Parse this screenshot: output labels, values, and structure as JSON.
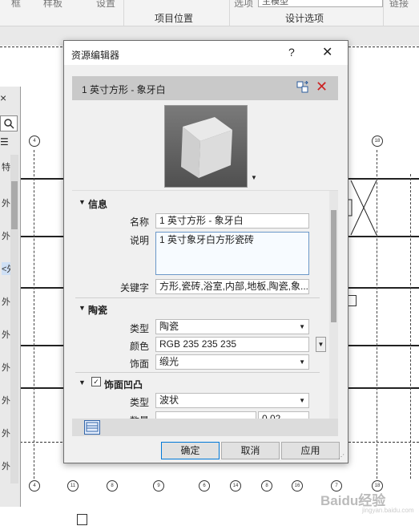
{
  "ribbon": {
    "partial_labels": [
      "框",
      "样板",
      "设置",
      "选项",
      "链接"
    ],
    "location_group": "项目位置",
    "design_options_group": "设计选项",
    "main_model_value": "主模型"
  },
  "browser": {
    "close_glyph": "×",
    "view_glyph": "☰",
    "header_fragment": "特",
    "rows": [
      "外",
      "外",
      "<外",
      "外",
      "外",
      "外",
      "外",
      "外",
      "外"
    ]
  },
  "grid_bubbles": {
    "top": [
      "4",
      "18"
    ],
    "bottom": [
      "4",
      "11",
      "8",
      "9",
      "6",
      "14",
      "8",
      "16",
      "7",
      "18"
    ]
  },
  "dialog": {
    "title": "资源编辑器",
    "help_glyph": "?",
    "close_glyph": "✕",
    "asset_name": "1 英寸方形 - 象牙白",
    "delete_glyph": "✕",
    "sections": {
      "info": {
        "header": "信息",
        "name_label": "名称",
        "name_value": "1 英寸方形 - 象牙白",
        "desc_label": "说明",
        "desc_value": "1 英寸象牙白方形瓷砖",
        "keywords_label": "关键字",
        "keywords_value": "方形,瓷砖,浴室,内部,地板,陶瓷,象..."
      },
      "ceramic": {
        "header": "陶瓷",
        "type_label": "类型",
        "type_value": "陶瓷",
        "color_label": "颜色",
        "color_value": "RGB 235 235 235",
        "finish_label": "饰面",
        "finish_value": "缎光"
      },
      "bump": {
        "header": "饰面凹凸",
        "checked": true,
        "type_label": "类型",
        "type_value": "波状",
        "amount_label": "数量",
        "amount_value": "0.02"
      }
    },
    "buttons": {
      "ok": "确定",
      "cancel": "取消",
      "apply": "应用"
    }
  },
  "watermark": {
    "brand": "Baidu经验",
    "url": "jingyan.baidu.com"
  }
}
